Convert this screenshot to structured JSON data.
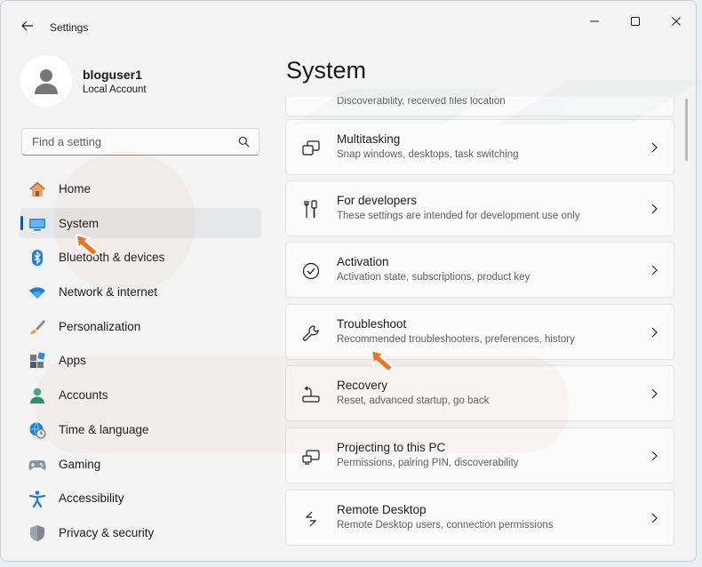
{
  "window": {
    "title": "Settings"
  },
  "profile": {
    "name": "bloguser1",
    "account_type": "Local Account"
  },
  "search": {
    "placeholder": "Find a setting"
  },
  "nav": {
    "items": [
      {
        "label": "Home",
        "icon": "home-icon"
      },
      {
        "label": "System",
        "icon": "monitor-icon",
        "selected": true
      },
      {
        "label": "Bluetooth & devices",
        "icon": "bluetooth-icon"
      },
      {
        "label": "Network & internet",
        "icon": "wifi-icon"
      },
      {
        "label": "Personalization",
        "icon": "brush-icon"
      },
      {
        "label": "Apps",
        "icon": "apps-icon"
      },
      {
        "label": "Accounts",
        "icon": "person-icon"
      },
      {
        "label": "Time & language",
        "icon": "globe-clock-icon"
      },
      {
        "label": "Gaming",
        "icon": "gamepad-icon"
      },
      {
        "label": "Accessibility",
        "icon": "accessibility-icon"
      },
      {
        "label": "Privacy & security",
        "icon": "shield-icon"
      }
    ]
  },
  "page": {
    "title": "System",
    "partial_item": {
      "subtitle": "Discoverability, received files location"
    },
    "cards": [
      {
        "title": "Multitasking",
        "subtitle": "Snap windows, desktops, task switching",
        "icon": "multitasking-icon"
      },
      {
        "title": "For developers",
        "subtitle": "These settings are intended for development use only",
        "icon": "developer-tools-icon"
      },
      {
        "title": "Activation",
        "subtitle": "Activation state, subscriptions, product key",
        "icon": "activation-check-icon"
      },
      {
        "title": "Troubleshoot",
        "subtitle": "Recommended troubleshooters, preferences, history",
        "icon": "wrench-icon"
      },
      {
        "title": "Recovery",
        "subtitle": "Reset, advanced startup, go back",
        "icon": "recovery-icon"
      },
      {
        "title": "Projecting to this PC",
        "subtitle": "Permissions, pairing PIN, discoverability",
        "icon": "projector-icon"
      },
      {
        "title": "Remote Desktop",
        "subtitle": "Remote Desktop users, connection permissions",
        "icon": "remote-desktop-icon"
      }
    ]
  },
  "colors": {
    "accent": "#005fb8",
    "pointer": "#f0731e",
    "background": "#f3f3f3",
    "card": "#fbfbfb"
  }
}
